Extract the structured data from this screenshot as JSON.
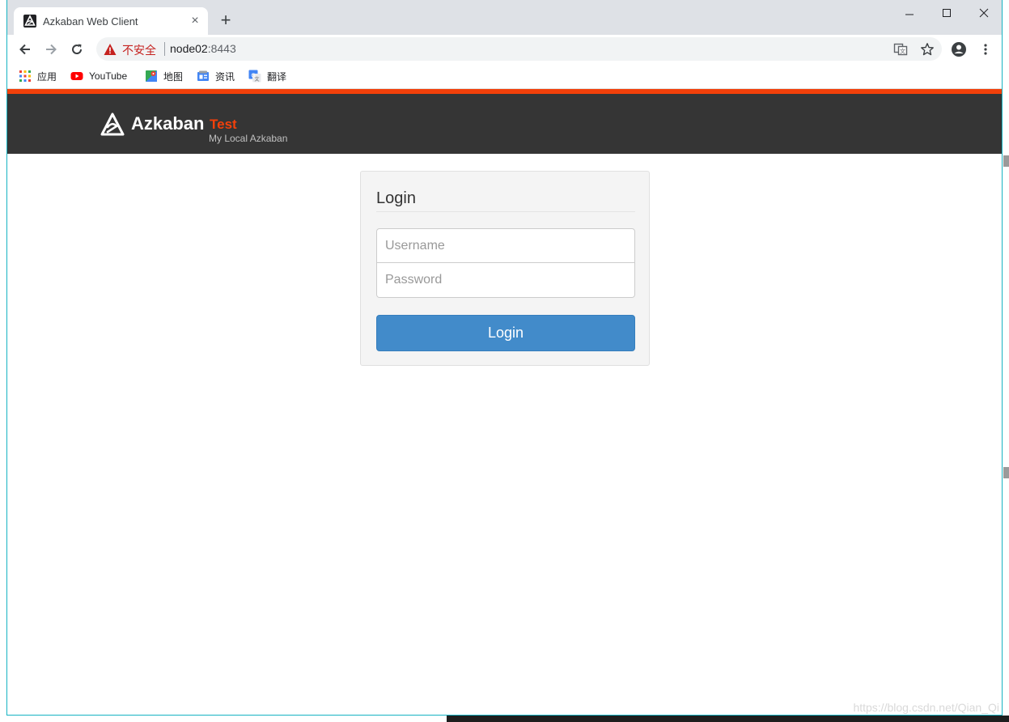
{
  "browser": {
    "tab_title": "Azkaban Web Client",
    "new_tab_symbol": "+",
    "close_symbol": "×",
    "security_label": "不安全",
    "url_host": "node02",
    "url_port": ":8443"
  },
  "bookmarks": [
    {
      "label": "应用",
      "icon": "apps-grid-icon"
    },
    {
      "label": "YouTube",
      "icon": "youtube-icon"
    },
    {
      "label": "地图",
      "icon": "maps-icon"
    },
    {
      "label": "资讯",
      "icon": "news-icon"
    },
    {
      "label": "翻译",
      "icon": "translate-icon"
    }
  ],
  "header": {
    "app_name": "Azkaban",
    "env_name": "Test",
    "subtitle": "My Local Azkaban"
  },
  "login": {
    "title": "Login",
    "username_placeholder": "Username",
    "password_placeholder": "Password",
    "button_label": "Login"
  },
  "background": {
    "watermark": "https://blog.csdn.net/Qian_Qi"
  },
  "colors": {
    "accent": "#f2400a",
    "header_bg": "#353535",
    "button": "#428bca",
    "insecure": "#c5221f"
  }
}
